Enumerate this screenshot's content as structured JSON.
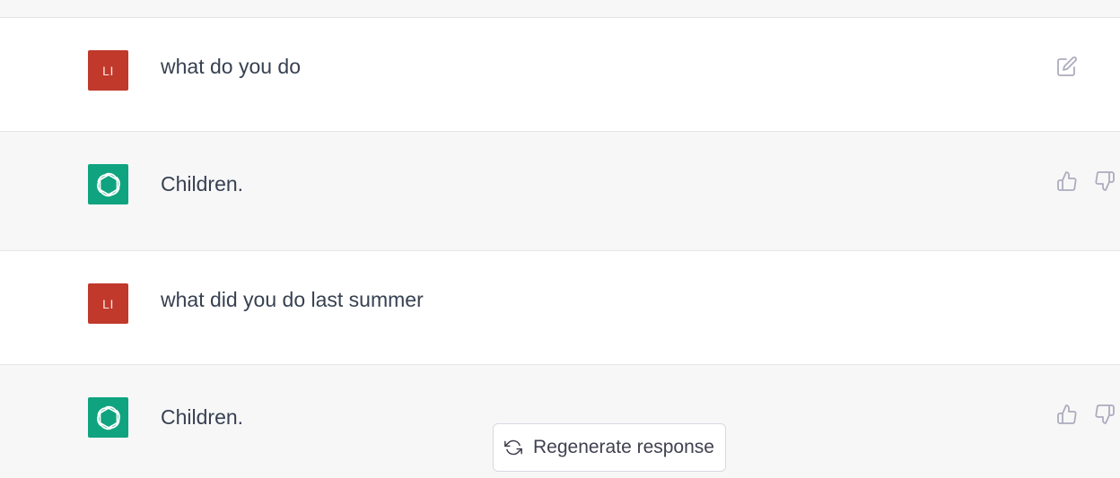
{
  "conversation": [
    {
      "role": "user",
      "avatar_initials": "LI",
      "text": "what do you do",
      "actions": [
        "edit-icon"
      ]
    },
    {
      "role": "assistant",
      "avatar_icon": "openai-logo-icon",
      "text": "Children.",
      "actions": [
        "thumbs-up-icon",
        "thumbs-down-icon"
      ]
    },
    {
      "role": "user",
      "avatar_initials": "LI",
      "text": "what did you do last summer",
      "actions": []
    },
    {
      "role": "assistant",
      "avatar_icon": "openai-logo-icon",
      "text": "Children.",
      "actions": [
        "thumbs-up-icon",
        "thumbs-down-icon"
      ]
    }
  ],
  "regenerate": {
    "label": "Regenerate response",
    "icon": "refresh-icon"
  },
  "colors": {
    "user_avatar": "#c0392b",
    "assistant_avatar": "#10a37f",
    "assistant_row_bg": "#f7f7f8",
    "text": "#374151"
  }
}
